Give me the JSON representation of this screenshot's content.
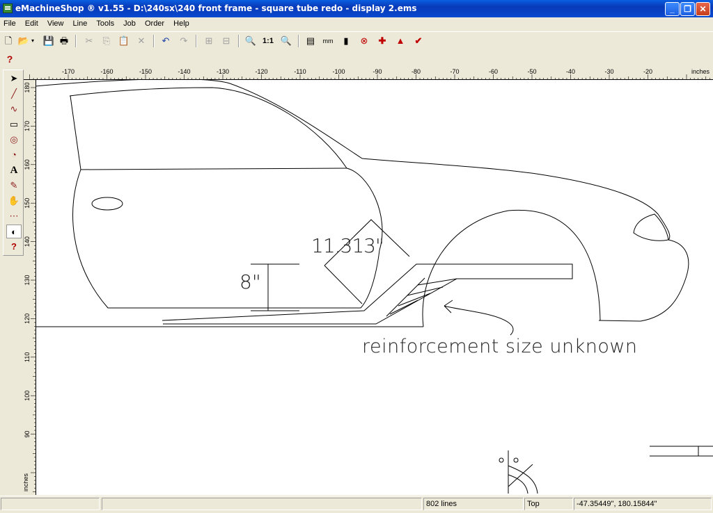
{
  "window": {
    "title": "eMachineShop ® v1.55 - D:\\240sx\\240 front frame - square tube redo - display 2.ems",
    "minimize": "_",
    "restore": "❐",
    "close": "✕"
  },
  "menu": [
    "File",
    "Edit",
    "View",
    "Line",
    "Tools",
    "Job",
    "Order",
    "Help"
  ],
  "toolbar": {
    "new": "🗋",
    "open": "📂",
    "save": "💾",
    "print": "🖶",
    "cut": "✂",
    "copy": "⎘",
    "paste": "📋",
    "delete": "✕",
    "undo": "↶",
    "redo": "↷",
    "zoom": "🔍",
    "zoom_1to1": "1:1",
    "zoom_fit": "🔍",
    "units_mm": "mm",
    "help": "?"
  },
  "left_tools": {
    "select": "➤",
    "line": "╱",
    "curve": "∿",
    "rect": "▭",
    "circle": "◎",
    "arc": "◔",
    "text": "A",
    "pen": "✎",
    "pan": "✋",
    "grid": "⋯",
    "node": "◐",
    "help": "?"
  },
  "ruler": {
    "unit": "inches",
    "top_ticks": [
      "-170",
      "-160",
      "-150",
      "-140",
      "-130",
      "-120",
      "-110",
      "-100",
      "-90",
      "-80",
      "-70",
      "-60",
      "-50",
      "-40",
      "-30",
      "-20"
    ],
    "left_ticks": [
      "180",
      "170",
      "160",
      "150",
      "140",
      "130",
      "120",
      "110",
      "100",
      "90"
    ]
  },
  "drawing": {
    "dimension_diagonal": "11.313\"",
    "dimension_height": "8\"",
    "annotation": "reinforcement size unknown"
  },
  "status": {
    "cell1": "",
    "cell2": "",
    "line_count": "802 lines",
    "view": "Top",
    "coords": "-47.35449\", 180.15844\""
  },
  "colors": {
    "titlebar": "#0a4ad0",
    "chrome": "#ece9d8",
    "help_red": "#b00000",
    "canvas": "#ffffff"
  }
}
